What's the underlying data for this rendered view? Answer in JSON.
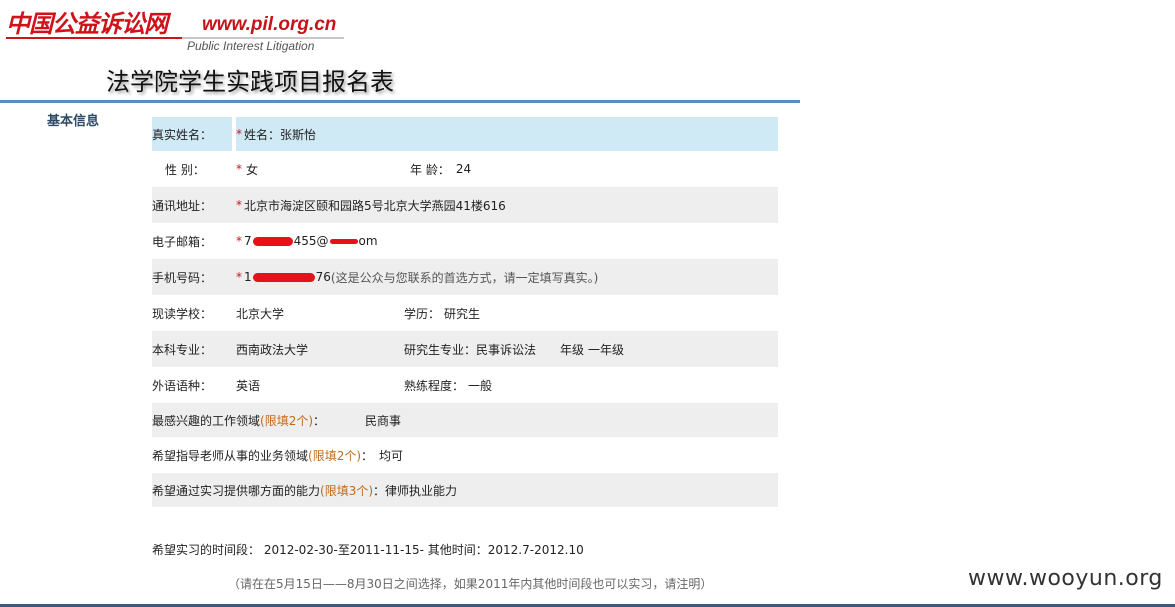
{
  "header": {
    "logo_cn": "中国公益诉讼网",
    "logo_url": "www.pil.org.cn",
    "logo_en": "Public Interest Litigation",
    "page_title": "法学院学生实践项目报名表",
    "section_label": "基本信息"
  },
  "form": {
    "name_label": "真实姓名：",
    "name_value": "*姓名：张斯怡",
    "gender_label": "性 别：",
    "gender_star": "*",
    "gender_value": "女",
    "age_label": "年 龄：",
    "age_value": "24",
    "address_label": "通讯地址：",
    "address_star": "*",
    "address_value": "北京市海淀区颐和园路5号北京大学燕园41楼616",
    "email_label": "电子邮箱：",
    "email_star": "*",
    "email_prefix": "7",
    "email_suffix": "455@",
    "email_end": "om",
    "phone_label": "手机号码：",
    "phone_star": "*",
    "phone_prefix": "1",
    "phone_suffix": "76",
    "phone_hint": "(这是公众与您联系的首选方式，请一定填写真实。)",
    "school_label": "现读学校：",
    "school_value": "北京大学",
    "degree_label": "学历：",
    "degree_value": "研究生",
    "undergrad_label": "本科专业：",
    "undergrad_value": "西南政法大学",
    "grad_major_label": "研究生专业：",
    "grad_major_value": "民事诉讼法",
    "grade_label": "年级",
    "grade_value": "一年级",
    "language_label": "外语语种：",
    "language_value": "英语",
    "proficiency_label": "熟练程度：",
    "proficiency_value": "一般",
    "interest_label": "最感兴趣的工作领域",
    "interest_limit": "(限填2个)",
    "interest_colon": "：",
    "interest_value": "民商事",
    "mentor_label": "希望指导老师从事的业务领域",
    "mentor_limit": "(限填2个)",
    "mentor_colon": "：",
    "mentor_value": "均可",
    "ability_label": "希望通过实习提供哪方面的能力",
    "ability_limit": "(限填3个)",
    "ability_colon": "：",
    "ability_value": "律师执业能力"
  },
  "footer": {
    "time_text": "希望实习的时间段： 2012-02-30-至2011-11-15-  其他时间：2012.7-2012.10",
    "note_text": "（请在在5月15日——8月30日之间选择，如果2011年内其他时间段也可以实习，请注明）",
    "watermark": "www.wooyun.org"
  },
  "colors": {
    "accent_red": "#d0121b",
    "title_bar": "#5a8cbf",
    "highlight_row": "#cfe9f5",
    "shaded_row": "#eeeeee",
    "limit_orange": "#c26a18"
  }
}
